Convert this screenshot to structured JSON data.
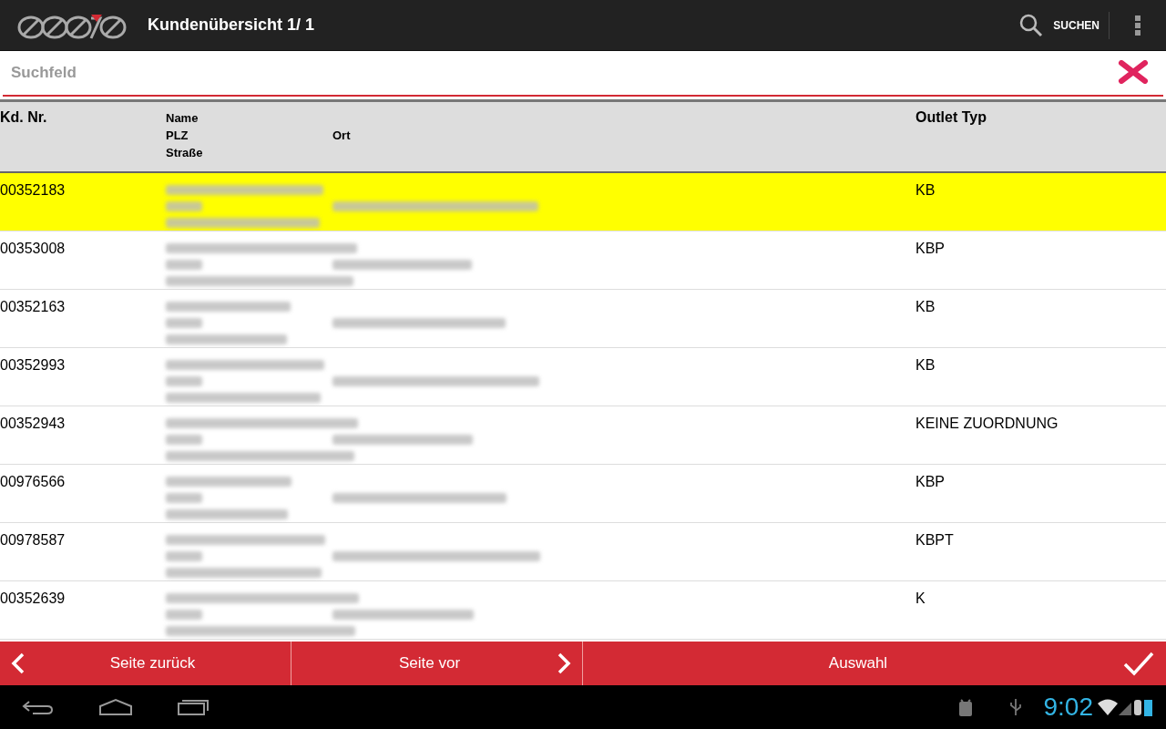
{
  "action_bar": {
    "title": "Kundenübersicht 1/ 1",
    "search_label": "SUCHEN"
  },
  "search": {
    "placeholder": "Suchfeld"
  },
  "table": {
    "columns": {
      "number": "Kd. Nr.",
      "name": "Name",
      "plz": "PLZ",
      "ort": "Ort",
      "street": "Straße",
      "outlet": "Outlet Typ"
    },
    "rows": [
      {
        "number": "00352183",
        "outlet": "KB",
        "selected": true
      },
      {
        "number": "00353008",
        "outlet": "KBP",
        "selected": false
      },
      {
        "number": "00352163",
        "outlet": "KB",
        "selected": false
      },
      {
        "number": "00352993",
        "outlet": "KB",
        "selected": false
      },
      {
        "number": "00352943",
        "outlet": "KEINE ZUORDNUNG",
        "selected": false
      },
      {
        "number": "00976566",
        "outlet": "KBP",
        "selected": false
      },
      {
        "number": "00978587",
        "outlet": "KBPT",
        "selected": false
      },
      {
        "number": "00352639",
        "outlet": "K",
        "selected": false
      }
    ]
  },
  "bottom_bar": {
    "back": "Seite zurück",
    "forward": "Seite vor",
    "select": "Auswahl"
  },
  "status_bar": {
    "time": "9:02"
  }
}
